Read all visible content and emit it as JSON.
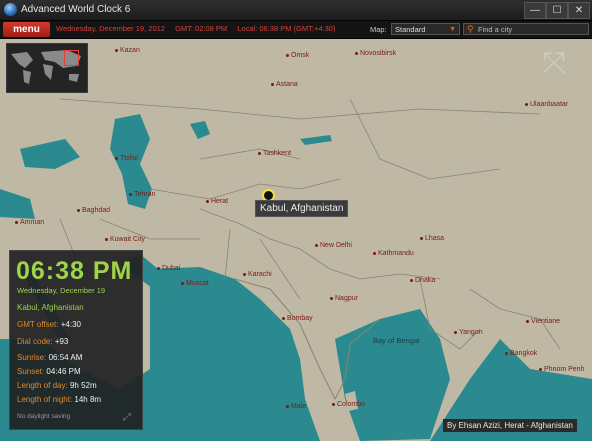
{
  "window": {
    "title": "Advanced World Clock 6",
    "minimize": "—",
    "maximize": "☐",
    "close": "✕"
  },
  "toolbar": {
    "menu_label": "menu",
    "date": "Wednesday, December 19, 2012",
    "gmt": "GMT: 02:08 PM",
    "local": "Local: 06:38 PM (GMT:+4:30)",
    "map_label": "Map:",
    "map_value": "Standard",
    "search_placeholder": "Find a city"
  },
  "map": {
    "colors": {
      "land": "#bfb8a4",
      "water": "#2a8a8f",
      "border": "#8a8373",
      "accent": "#e2413a"
    },
    "selected_city": "Kabul, Afghanistan",
    "seas": [
      "Bay of Bengal"
    ],
    "cities": [
      "Kazan",
      "Omsk",
      "Novosibirsk",
      "Astana",
      "Ulaanbaatar",
      "Tashkent",
      "Tbilisi",
      "Tehran",
      "Herat",
      "Baghdad",
      "Amman",
      "Kuwait City",
      "Dubai",
      "Muscat",
      "Karachi",
      "New Delhi",
      "Kathmandu",
      "Lhasa",
      "Dhaka",
      "Nagpur",
      "Bombay",
      "Yangon",
      "Vientiane",
      "Bangkok",
      "Colombo",
      "Male",
      "Phnom Penh"
    ]
  },
  "panel": {
    "time": "06:38 PM",
    "date": "Wednesday, December 19",
    "city": "Kabul, Afghanistan",
    "gmt_label": "GMT offset:",
    "gmt_value": "+4:30",
    "dial_label": "Dial code:",
    "dial_value": "+93",
    "sunrise_label": "Sunrise:",
    "sunrise_value": "06:54 AM",
    "sunset_label": "Sunset:",
    "sunset_value": "04:46 PM",
    "day_label": "Length of day:",
    "day_value": "9h 52m",
    "night_label": "Length of night:",
    "night_value": "14h 8m",
    "dst_note": "No daylight saving"
  },
  "credit": "By Ehsan Azizi, Herat - Afghanistan"
}
